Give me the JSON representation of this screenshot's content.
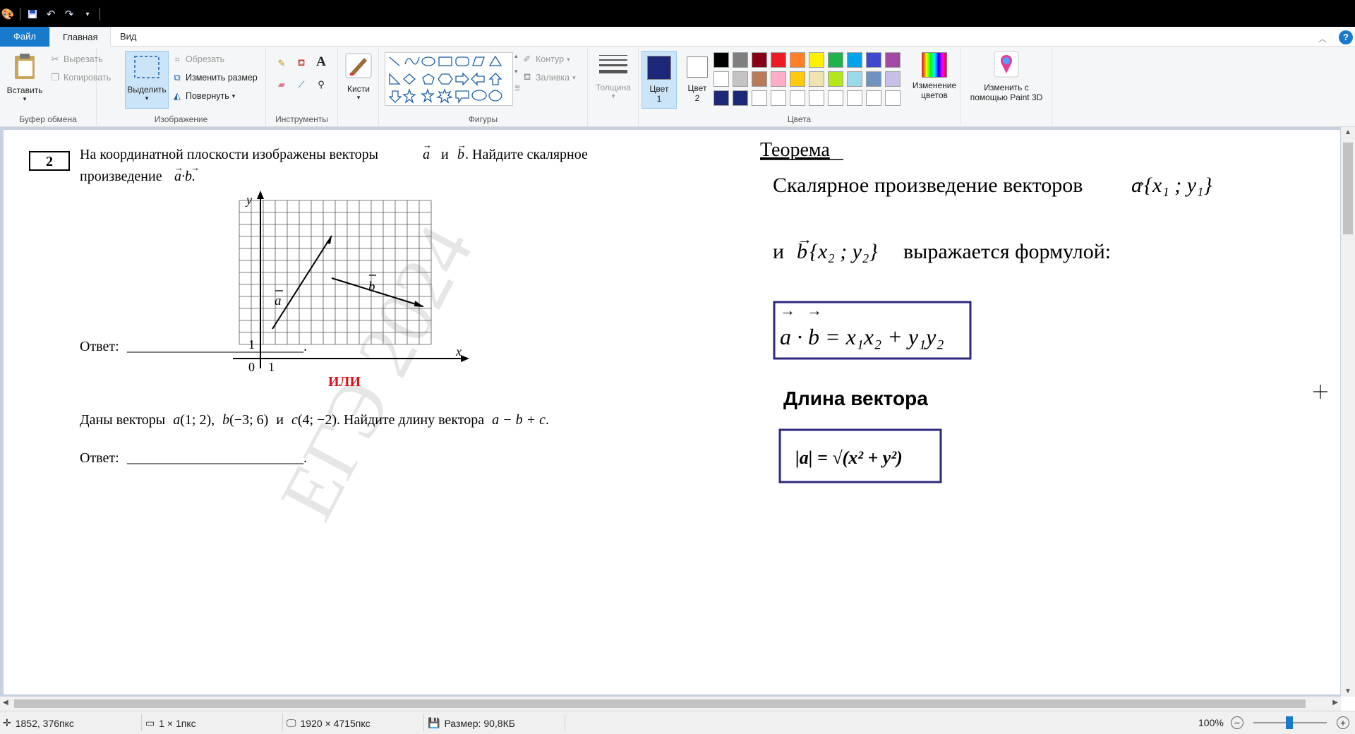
{
  "menu": {
    "file": "Файл",
    "home": "Главная",
    "view": "Вид"
  },
  "clipboard": {
    "paste": "Вставить",
    "cut": "Вырезать",
    "copy": "Копировать",
    "label": "Буфер обмена"
  },
  "image": {
    "select": "Выделить",
    "crop": "Обрезать",
    "resize": "Изменить размер",
    "rotate": "Повернуть",
    "label": "Изображение"
  },
  "tools": {
    "label": "Инструменты",
    "brushes": "Кисти"
  },
  "shapes": {
    "label": "Фигуры",
    "outline": "Контур",
    "fill": "Заливка"
  },
  "size": {
    "label": "Толщина"
  },
  "colors": {
    "color1": "Цвет",
    "color1_num": "1",
    "color2": "Цвет",
    "color2_num": "2",
    "edit_line1": "Изменение",
    "edit_line2": "цветов",
    "label": "Цвета",
    "color1_value": "#1d2777",
    "palette": [
      "#000000",
      "#7f7f7f",
      "#880015",
      "#ed1c24",
      "#ff7f27",
      "#fff200",
      "#22b14c",
      "#00a2e8",
      "#3f48cc",
      "#a349a4",
      "#ffffff",
      "#c3c3c3",
      "#b97a57",
      "#ffaec9",
      "#ffc90e",
      "#efe4b0",
      "#b5e61d",
      "#99d9ea",
      "#7092be",
      "#c8bfe7",
      "#1d2777",
      "#1d2777",
      "#ffffff",
      "#ffffff",
      "#ffffff",
      "#ffffff",
      "#ffffff",
      "#ffffff",
      "#ffffff",
      "#ffffff"
    ]
  },
  "paint3d": {
    "line1": "Изменить с",
    "line2": "помощью Paint 3D"
  },
  "status": {
    "cursor": "1852, 376пкс",
    "selection": "1 × 1пкс",
    "image_size": "1920 × 4715пкс",
    "file_size": "Размер: 90,8КБ",
    "zoom": "100%"
  },
  "doc": {
    "task_number": "2",
    "task1_line1": "На координатной плоскости изображены векторы",
    "task1_and": "и",
    "task1_tail": ". Найдите скалярное",
    "task1_line2": "произведение",
    "vec_a": "a",
    "vec_b": "b",
    "vec_c": "c",
    "answer_label": "Ответ:",
    "answer_line": "_________________________.",
    "or": "ИЛИ",
    "task2_start": "Даны векторы",
    "task2_a": "(1; 2),",
    "task2_b": "(−3; 6)",
    "task2_and": "и",
    "task2_c": "(4; −2). Найдите длину вектора",
    "task2_expr": "a − b + c",
    "task2_end": ".",
    "axis_y": "y",
    "axis_x": "x",
    "tick_0": "0",
    "tick_1": "1",
    "tick_1y": "1",
    "label_a": "a",
    "label_b": "b",
    "watermark": "ЕГЭ 2024",
    "theorem_title": "Теорема",
    "theorem_line1": "Скалярное произведение векторов",
    "theorem_line1_coords": "{x₁ ; y₁}",
    "theorem_and": "и",
    "theorem_line2_coords": "{x₂ ; y₂}",
    "theorem_line2_tail": "выражается формулой:",
    "formula": "a · b = x₁x₂ + y₁y₂",
    "length_title": "Длина вектора",
    "length_formula": "|a| = √(x² + y²)"
  }
}
